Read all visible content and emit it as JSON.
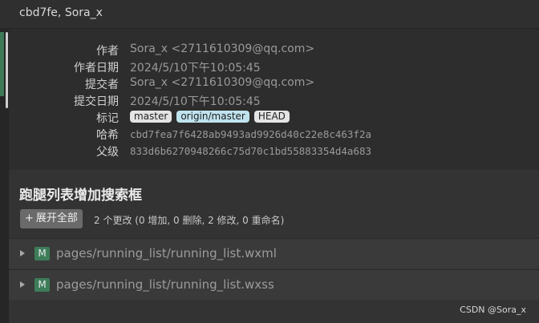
{
  "window": {
    "title": "cbd7fe, Sora_x"
  },
  "meta": {
    "author_label": "作者",
    "author_value": "Sora_x <2711610309@qq.com>",
    "author_date_label": "作者日期",
    "author_date_value": "2024/5/10下午10:05:45",
    "committer_label": "提交者",
    "committer_value": "Sora_x <2711610309@qq.com>",
    "commit_date_label": "提交日期",
    "commit_date_value": "2024/5/10下午10:05:45",
    "tags_label": "标记",
    "tags": [
      "master",
      "origin/master",
      "HEAD"
    ],
    "hash_label": "哈希",
    "hash_value": "cbd7fea7f6428ab9493ad9926d40c22e8c463f2a",
    "parent_label": "父级",
    "parent_value": "833d6b6270948266c75d70c1bd55883354d4a683"
  },
  "commit": {
    "message": "跑腿列表增加搜索框",
    "expand_all_label": "展开全部",
    "expand_all_icon": "+",
    "change_summary": "2 个更改 (0 增加, 0 删除, 2 修改, 0 重命名)"
  },
  "files": [
    {
      "status": "M",
      "path": "pages/running_list/running_list.wxml"
    },
    {
      "status": "M",
      "path": "pages/running_list/running_list.wxss"
    }
  ],
  "watermark": "CSDN @Sora_x"
}
